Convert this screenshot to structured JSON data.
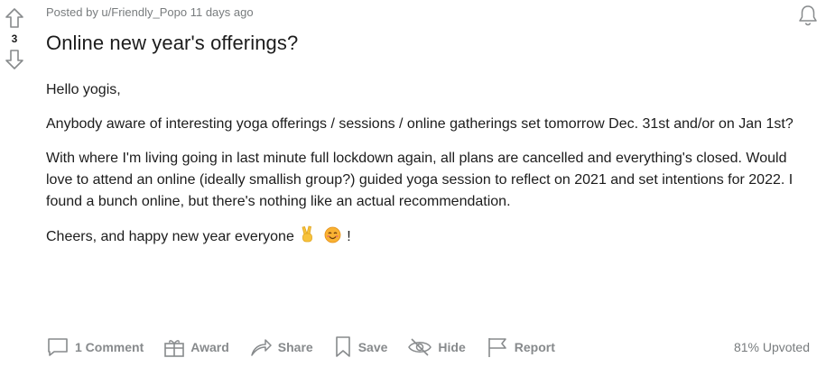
{
  "post": {
    "score": "3",
    "meta": "Posted by u/Friendly_Popo 11 days ago",
    "title": "Online new year's offerings?",
    "paragraphs": [
      "Hello yogis,",
      "Anybody aware of interesting yoga offerings / sessions / online gatherings set tomorrow Dec. 31st and/or on Jan 1st?",
      "With where I'm living going in last minute full lockdown again, all plans are cancelled and everything's closed. Would love to attend an online (ideally smallish group?) guided yoga session to reflect on 2021 and set intentions for 2022. I found a bunch online, but there's nothing like an actual recommendation."
    ],
    "last_line_text": "Cheers, and happy new year everyone",
    "last_line_end": "!",
    "emojis": [
      "victory-hand-emoji",
      "smiling-face-emoji"
    ]
  },
  "actions": {
    "comments": "1 Comment",
    "award": "Award",
    "share": "Share",
    "save": "Save",
    "hide": "Hide",
    "report": "Report",
    "upvoted": "81% Upvoted"
  },
  "colors": {
    "text": "#1c1c1c",
    "muted": "#878a8c",
    "meta": "#787c7e",
    "background": "#ffffff"
  }
}
